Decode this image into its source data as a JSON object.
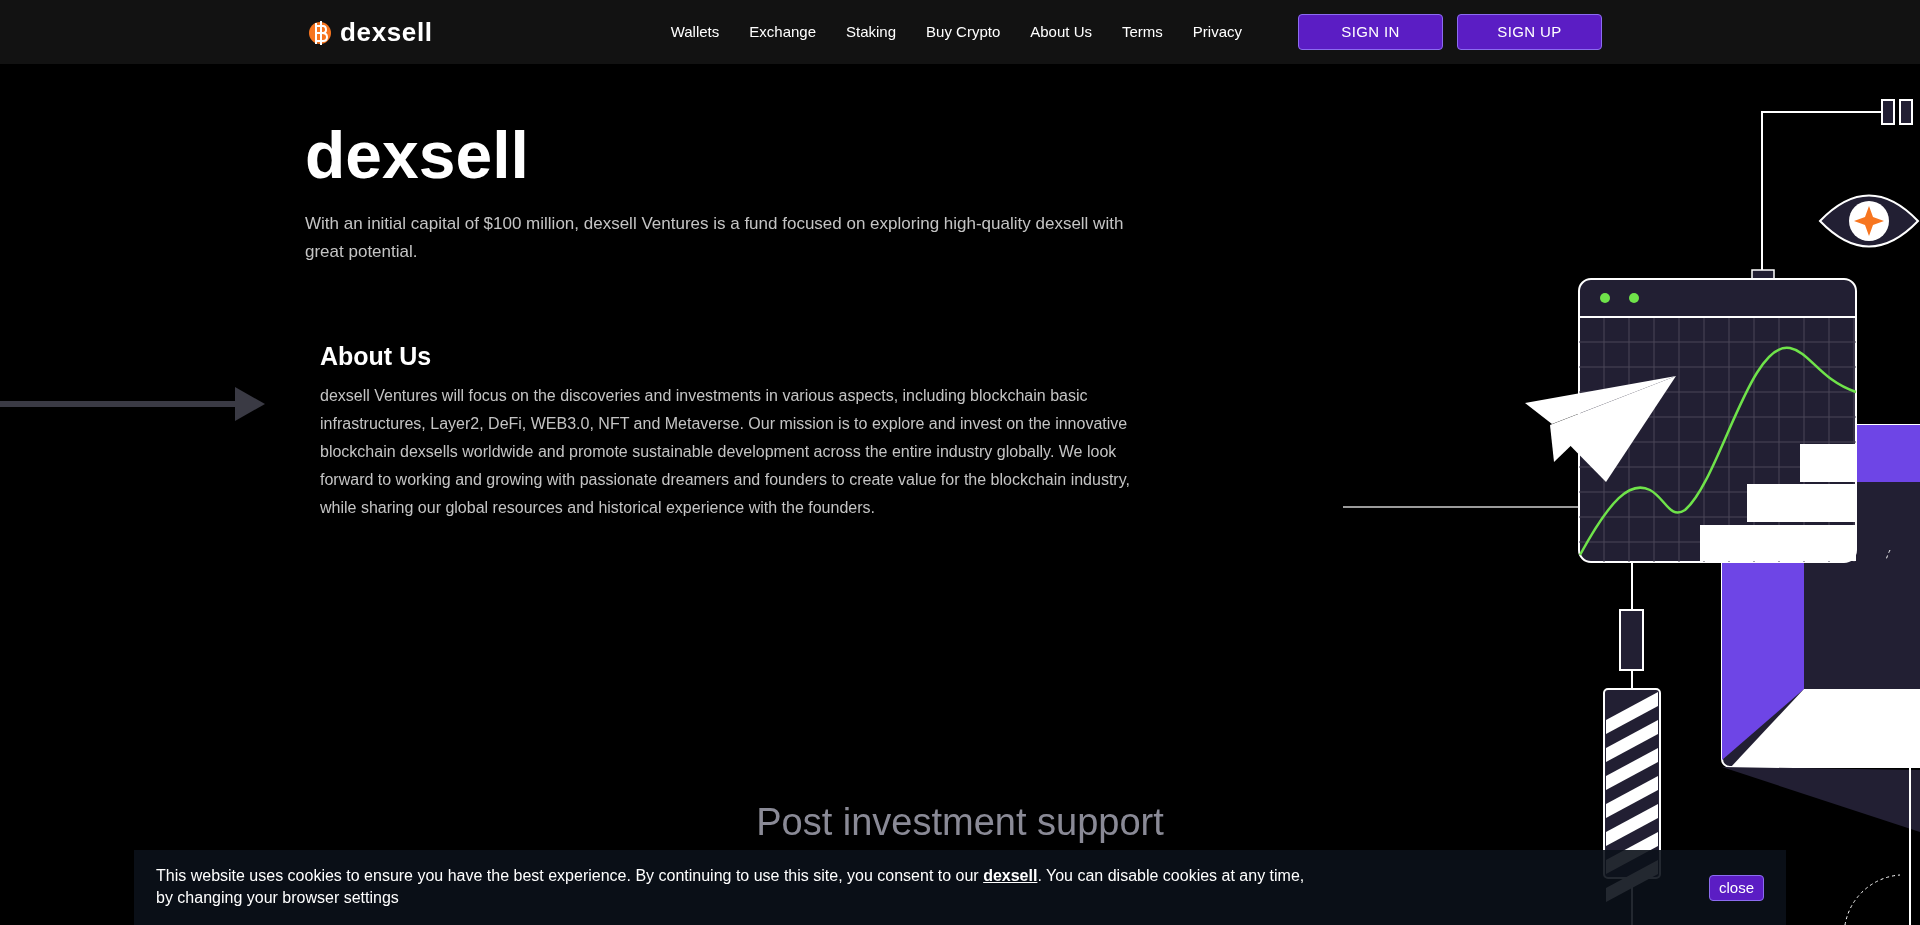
{
  "header": {
    "logo_text": "dexsell",
    "nav": [
      {
        "label": "Wallets"
      },
      {
        "label": "Exchange"
      },
      {
        "label": "Staking"
      },
      {
        "label": "Buy Crypto"
      },
      {
        "label": "About Us"
      },
      {
        "label": "Terms"
      },
      {
        "label": "Privacy"
      }
    ],
    "buttons": [
      "SIGN IN",
      "SIGN UP"
    ]
  },
  "hero": {
    "title": "dexsell",
    "text": "With an initial capital of $100 million, dexsell Ventures is a fund focused on exploring high-quality dexsell with great potential."
  },
  "about": {
    "title": "About Us",
    "text": "dexsell Ventures will focus on the discoveries and investments in various aspects, including blockchain basic infrastructures, Layer2, DeFi, WEB3.0, NFT and Metaverse. Our mission is to explore and invest on the innovative blockchain dexsells worldwide and promote sustainable development across the entire industry globally. We look forward to working and growing with passionate dreamers and founders to create value for the blockchain industry, while sharing our global resources and historical experience with the founders."
  },
  "next_section": {
    "title": "Post investment support"
  },
  "cookie_bar": {
    "text_before": "This website uses cookies to ensure you have the best experience. By continuing to use this site, you consent to our ",
    "link": "dexsell",
    "text_after": ". You can disable cookies at any time, by changing your browser settings",
    "button": "close"
  }
}
